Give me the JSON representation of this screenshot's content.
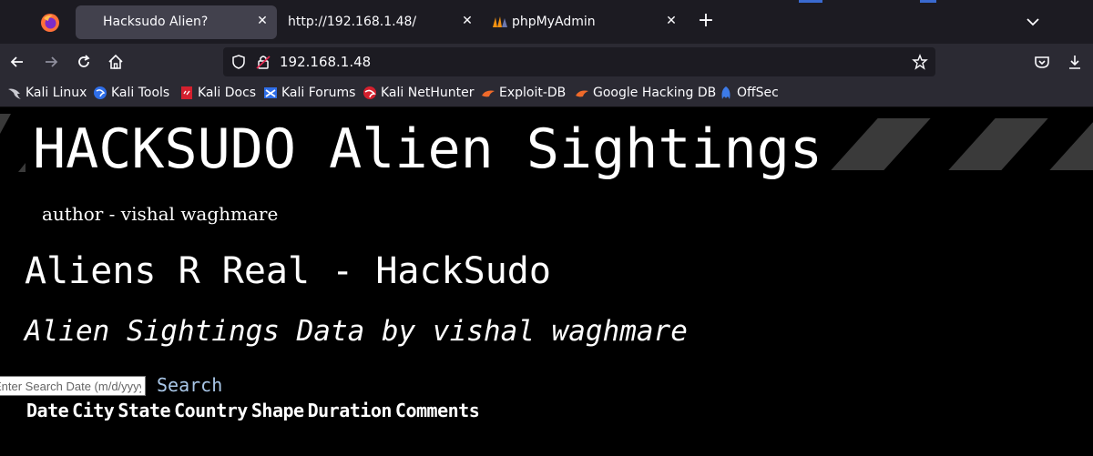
{
  "browser": {
    "tabs": [
      {
        "title": "Hacksudo Alien?",
        "active": true
      },
      {
        "title": "http://192.168.1.48/",
        "active": false
      },
      {
        "title": "phpMyAdmin",
        "active": false
      }
    ],
    "url": "192.168.1.48",
    "bookmarks": [
      {
        "label": "Kali Linux",
        "icon": "kali-dragon-icon"
      },
      {
        "label": "Kali Tools",
        "icon": "kali-tools-icon"
      },
      {
        "label": "Kali Docs",
        "icon": "kali-docs-icon"
      },
      {
        "label": "Kali Forums",
        "icon": "kali-forums-icon"
      },
      {
        "label": "Kali NetHunter",
        "icon": "nethunter-icon"
      },
      {
        "label": "Exploit-DB",
        "icon": "exploit-db-icon"
      },
      {
        "label": "Google Hacking DB",
        "icon": "ghdb-icon"
      },
      {
        "label": "OffSec",
        "icon": "offsec-icon"
      }
    ]
  },
  "page": {
    "title": "HACKSUDO Alien Sightings",
    "author": "author - vishal waghmare",
    "heading": "Aliens R Real - HackSudo",
    "subheading": "Alien Sightings Data by vishal waghmare",
    "search": {
      "placeholder": "Enter Search Date (m/d/yyyy)",
      "value": "",
      "link_label": "Search"
    },
    "table_headers": [
      "Date",
      "City",
      "State",
      "Country",
      "Shape",
      "Duration",
      "Comments"
    ]
  },
  "colors": {
    "tab_bar": "#1c1b22",
    "toolbar": "#2b2a33",
    "active_tab": "#42414d",
    "page_bg": "#000000",
    "link": "#a9c7e8",
    "stripe": "#3a3a3a"
  }
}
